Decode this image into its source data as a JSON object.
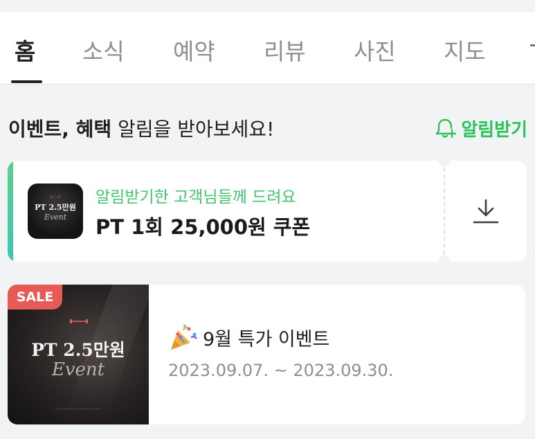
{
  "tabs": [
    {
      "label": "홈",
      "active": true
    },
    {
      "label": "소식"
    },
    {
      "label": "예약"
    },
    {
      "label": "리뷰"
    },
    {
      "label": "사진"
    },
    {
      "label": "지도"
    }
  ],
  "alert": {
    "bold": "이벤트, 혜택",
    "text": " 알림을 받아보세요!",
    "button_label": "알림받기",
    "button_icon": "bell-plus-icon"
  },
  "coupon": {
    "subtitle": "알림받기한 고객님들께 드려요",
    "title": "PT 1회 25,000원 쿠폰",
    "thumbnail": {
      "title": "PT 2.5만원",
      "script": "Event"
    },
    "action_icon": "download-icon"
  },
  "event": {
    "badge": "SALE",
    "title": "9월 특가 이벤트",
    "date": "2023.09.07. ~ 2023.09.30.",
    "image": {
      "title": "PT 2.5만원",
      "script": "Event"
    },
    "title_icon": "party-popper-icon"
  },
  "colors": {
    "accent_green": "#2bc25a",
    "sale_red": "#e85a55",
    "page_bg": "#f2f3f5"
  }
}
